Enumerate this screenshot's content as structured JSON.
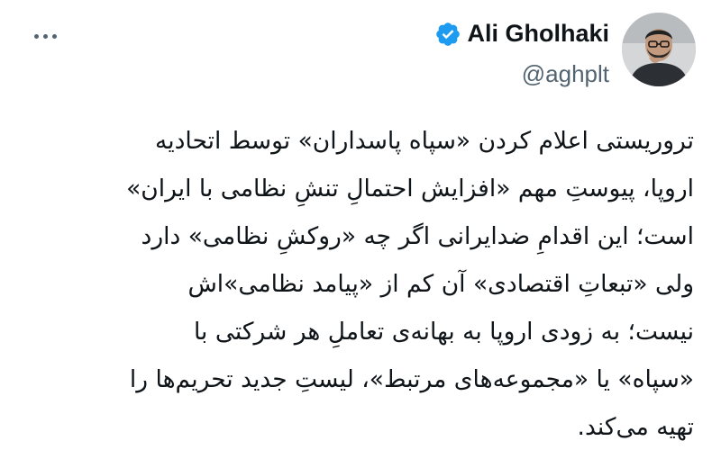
{
  "author": {
    "display_name": "Ali Gholhaki",
    "handle": "@aghplt",
    "verified": true,
    "verified_color": "#1d9bf0"
  },
  "menu": {
    "more_icon": "more-horizontal-icon"
  },
  "tweet": {
    "lines": [
      "تروریستی اعلام کردن «سپاه پاسداران» توسط اتحادیه",
      "اروپا، پیوستِ مهم «افزایش احتمالِ تنشِ نظامی با ایران»",
      "است؛ این اقدامِ ضدایرانی اگر چه «روکشِ نظامی» دارد",
      "ولی «تبعاتِ اقتصادی» آن کم از «پیامد نظامی»اش",
      "نیست؛ به زودی اروپا به بهانه‌ی تعاملِ هر شرکتی با",
      "«سپاه» یا «مجموعه‌های مرتبط»، لیستِ جدید تحریم‌ها را",
      "تهیه می‌کند."
    ]
  }
}
